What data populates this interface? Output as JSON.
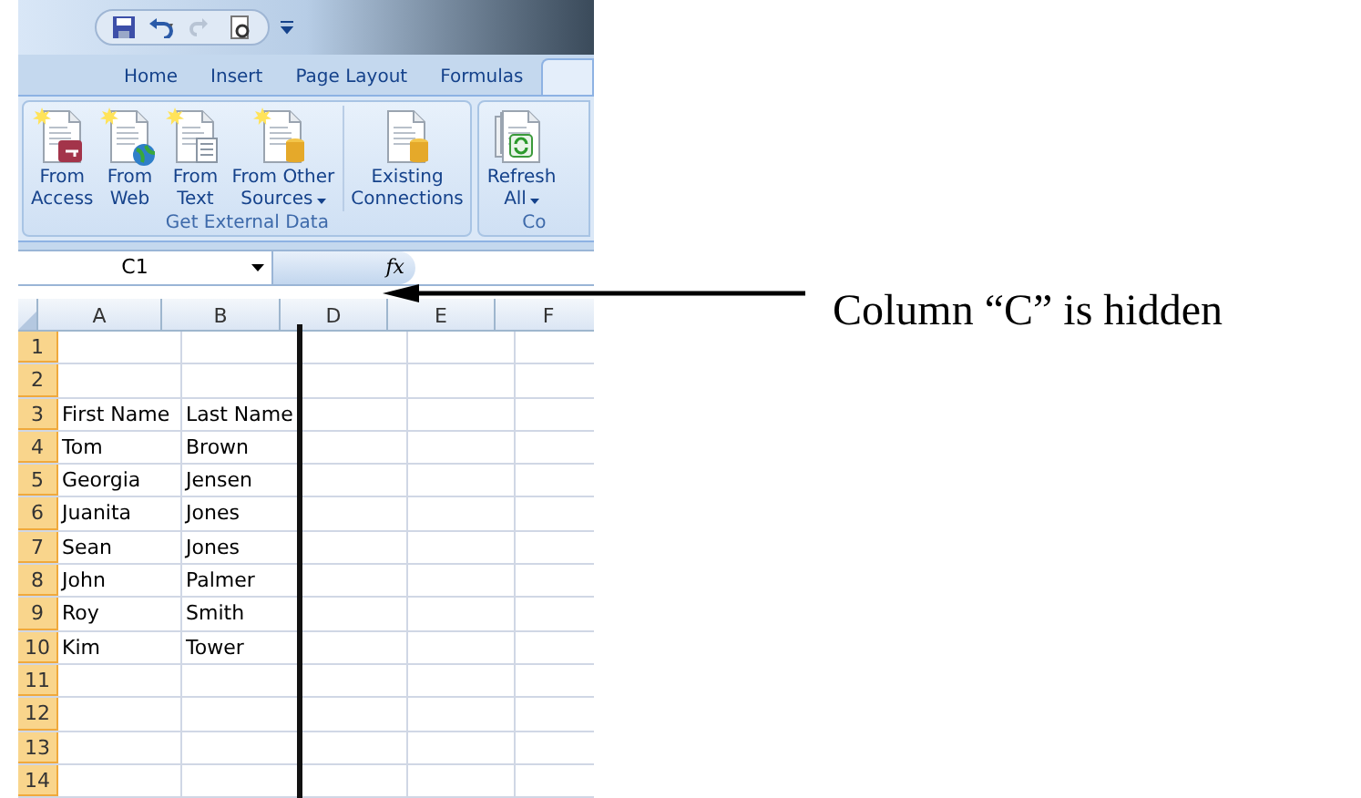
{
  "tabs": [
    {
      "label": "Home",
      "selected": false
    },
    {
      "label": "Insert",
      "selected": false
    },
    {
      "label": "Page Layout",
      "selected": false
    },
    {
      "label": "Formulas",
      "selected": false
    }
  ],
  "ribbon_groups": [
    {
      "label": "Get External Data",
      "buttons": [
        {
          "kind": "access",
          "lines": [
            "From",
            "Access"
          ],
          "dropdown": false
        },
        {
          "kind": "web",
          "lines": [
            "From",
            "Web"
          ],
          "dropdown": false
        },
        {
          "kind": "text",
          "lines": [
            "From",
            "Text"
          ],
          "dropdown": false
        },
        {
          "kind": "other",
          "lines": [
            "From Other",
            "Sources"
          ],
          "dropdown": true
        },
        {
          "kind": "existing",
          "lines": [
            "Existing",
            "Connections"
          ],
          "dropdown": false
        }
      ]
    },
    {
      "label": "Co",
      "buttons": [
        {
          "kind": "refresh",
          "lines": [
            "Refresh",
            "All"
          ],
          "dropdown": true
        }
      ]
    }
  ],
  "formula_bar": {
    "name_box": "C1",
    "function_label": "fx"
  },
  "sheet": {
    "columns": [
      "A",
      "B",
      "D",
      "E",
      "F"
    ],
    "rows": [
      {
        "number": "1"
      },
      {
        "number": "2"
      },
      {
        "number": "3",
        "cells": [
          "First Name",
          "Last Name"
        ]
      },
      {
        "number": "4",
        "cells": [
          "Tom",
          "Brown"
        ]
      },
      {
        "number": "5",
        "cells": [
          "Georgia",
          "Jensen"
        ]
      },
      {
        "number": "6",
        "cells": [
          "Juanita",
          "Jones"
        ]
      },
      {
        "number": "7",
        "cells": [
          "Sean",
          "Jones"
        ]
      },
      {
        "number": "8",
        "cells": [
          "John",
          "Palmer"
        ]
      },
      {
        "number": "9",
        "cells": [
          "Roy",
          "Smith"
        ]
      },
      {
        "number": "10",
        "cells": [
          "Kim",
          "Tower"
        ]
      },
      {
        "number": "11"
      },
      {
        "number": "12"
      },
      {
        "number": "13"
      },
      {
        "number": "14"
      }
    ]
  },
  "annotation": {
    "text": "Column “C” is hidden"
  }
}
